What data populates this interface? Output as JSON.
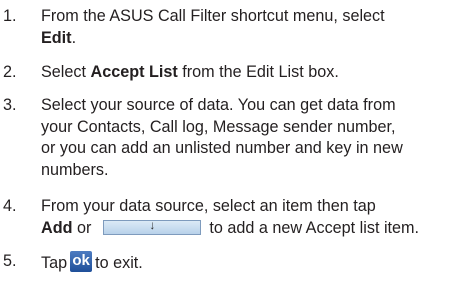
{
  "steps": [
    {
      "number": "1.",
      "lines": [
        {
          "a": "From the ASUS Call Filter shortcut menu, select"
        },
        {
          "bold": "Edit",
          "after": "."
        }
      ]
    },
    {
      "number": "2.",
      "before": "Select ",
      "bold": "Accept List",
      "after": " from the Edit List box."
    },
    {
      "number": "3.",
      "lines": [
        "Select your source of data. You can get data from",
        "your Contacts, Call log, Message sender number,",
        "or you can add an unlisted number and key in new",
        "numbers."
      ]
    },
    {
      "number": "4.",
      "line1": "From your data source, select an item then tap",
      "bold": "Add",
      "or_text": " or",
      "button_icon": "↓",
      "after": "to add a new Accept list item."
    },
    {
      "number": "5.",
      "before": "Tap",
      "ok_label": "ok",
      "after": "to exit."
    }
  ],
  "colors": {
    "text": "#231f20",
    "ok_button": "#2f5fa9",
    "down_button": "#c9dcef"
  }
}
